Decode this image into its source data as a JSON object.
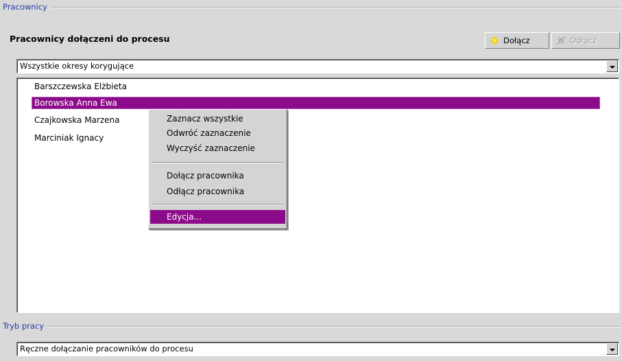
{
  "groups": {
    "employees": {
      "label": "Pracownicy"
    },
    "work_mode": {
      "label": "Tryb pracy"
    }
  },
  "section": {
    "title": "Pracownicy dołączeni do procesu"
  },
  "toolbar": {
    "attach_label": "Dołącz",
    "detach_label": "Odłącz",
    "attach_icon": "asterisk-icon",
    "detach_icon": "disconnect-icon"
  },
  "period_combo": {
    "value": "Wszystkie okresy korygujące"
  },
  "employee_list": {
    "items": [
      {
        "name": "Barszczewska Elżbieta",
        "selected": false
      },
      {
        "name": "Borowska Anna Ewa",
        "selected": true
      },
      {
        "name": "Czajkowska Marzena",
        "selected": false
      },
      {
        "name": "Marciniak Ignacy",
        "selected": false
      }
    ]
  },
  "context_menu": {
    "items": [
      {
        "label": "Zaznacz wszystkie"
      },
      {
        "label": "Odwróć zaznaczenie"
      },
      {
        "label": "Wyczyść zaznaczenie"
      },
      {
        "label": "Dołącz pracownika"
      },
      {
        "label": "Odłącz pracownika"
      },
      {
        "label": "Edycja...",
        "highlighted": true
      }
    ]
  },
  "mode_combo": {
    "value": "Ręczne dołączanie pracowników do procesu"
  },
  "colors": {
    "selection": "#8c0b8a",
    "group_label": "#1e3ca8",
    "attach_icon": "#f0d000"
  }
}
